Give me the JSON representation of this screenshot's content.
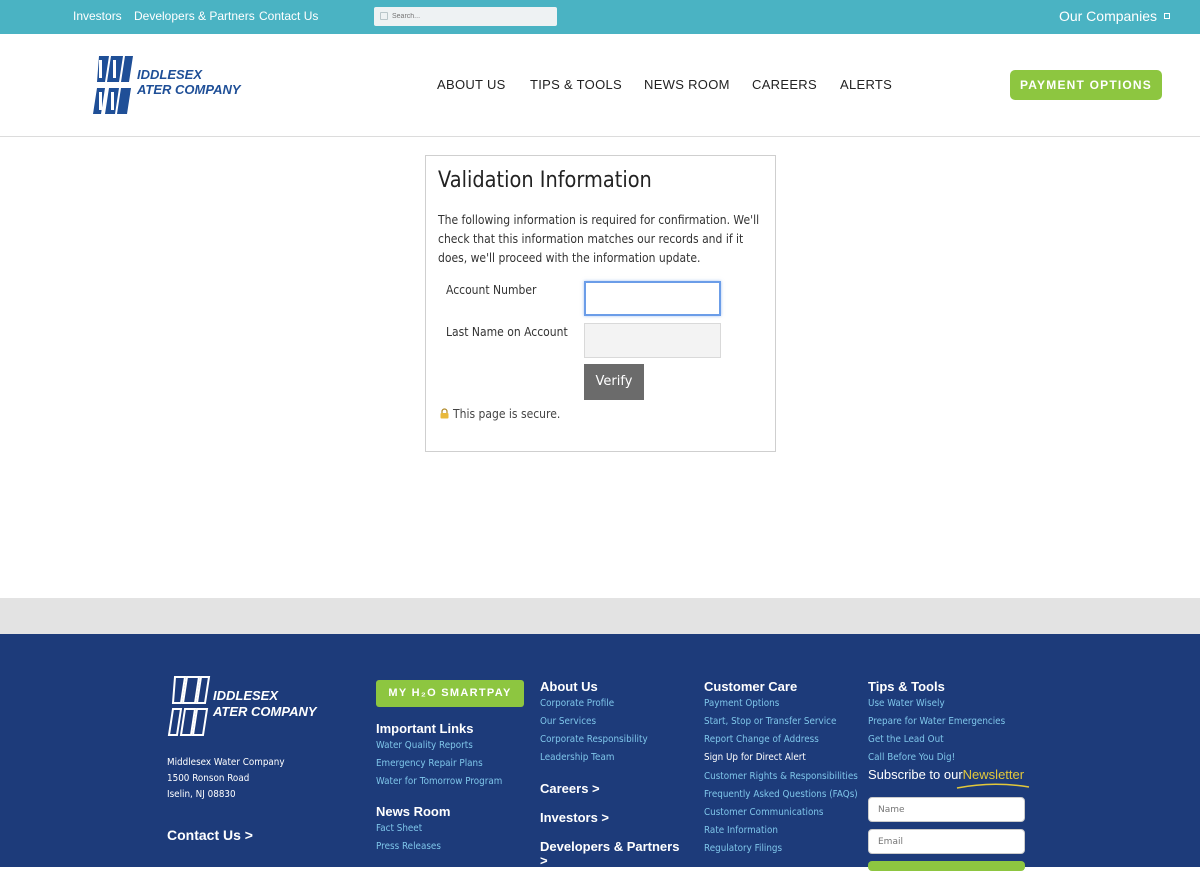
{
  "topbar": {
    "links": [
      "Investors",
      "Developers & Partners",
      "Contact Us"
    ],
    "search_placeholder": "Search...",
    "companies_label": "Our Companies"
  },
  "logo": {
    "line1": "IDDLESEX",
    "line2": "ATER COMPANY"
  },
  "nav": {
    "items": [
      "ABOUT US",
      "TIPS & TOOLS",
      "NEWS ROOM",
      "CAREERS",
      "ALERTS"
    ],
    "payment_button": "PAYMENT OPTIONS"
  },
  "form": {
    "title": "Validation Information",
    "description": "The following information is required for confirmation. We'll check that this information matches our records and if it does, we'll proceed with the information update.",
    "account_label": "Account Number",
    "account_value": "",
    "lastname_label": "Last Name on Account",
    "lastname_value": "",
    "verify_label": "Verify",
    "secure_text": "This page is secure."
  },
  "footer": {
    "address": [
      "Middlesex Water Company",
      "1500 Ronson Road",
      "Iselin, NJ 08830"
    ],
    "contact_label": "Contact Us >",
    "smartpay_label": "MY H₂O SMARTPAY",
    "important_links": {
      "title": "Important Links",
      "items": [
        "Water Quality Reports",
        "Emergency Repair Plans",
        "Water for Tomorrow Program"
      ]
    },
    "news_room": {
      "title": "News Room",
      "items": [
        "Fact Sheet",
        "Press Releases"
      ]
    },
    "about_us": {
      "title": "About Us",
      "items": [
        "Corporate Profile",
        "Our Services",
        "Corporate Responsibility",
        "Leadership Team"
      ]
    },
    "careers_label": "Careers >",
    "investors_label": "Investors >",
    "developers_label": "Developers & Partners",
    "developers_arrow": ">",
    "customer_care": {
      "title": "Customer Care",
      "items": [
        "Payment Options",
        "Start, Stop or Transfer Service",
        "Report Change of Address",
        "Sign Up for Direct Alert",
        "Customer Rights & Responsibilities",
        "Frequently Asked Questions (FAQs)",
        "Customer Communications",
        "Rate Information",
        "Regulatory Filings"
      ]
    },
    "tips_tools": {
      "title": "Tips & Tools",
      "items": [
        "Use Water Wisely",
        "Prepare for Water Emergencies",
        "Get the Lead Out",
        "Call Before You Dig!"
      ]
    },
    "newsletter": {
      "prefix": "Subscribe to our",
      "highlight": "Newsletter",
      "name_placeholder": "Name",
      "email_placeholder": "Email"
    }
  },
  "colors": {
    "topbar": "#4ab3c3",
    "brand_blue": "#1f4f97",
    "accent_green": "#8dc640",
    "footer_bg": "#1d3b7a",
    "footer_link": "#7fc6ea",
    "newsletter_highlight": "#e3c83a"
  }
}
